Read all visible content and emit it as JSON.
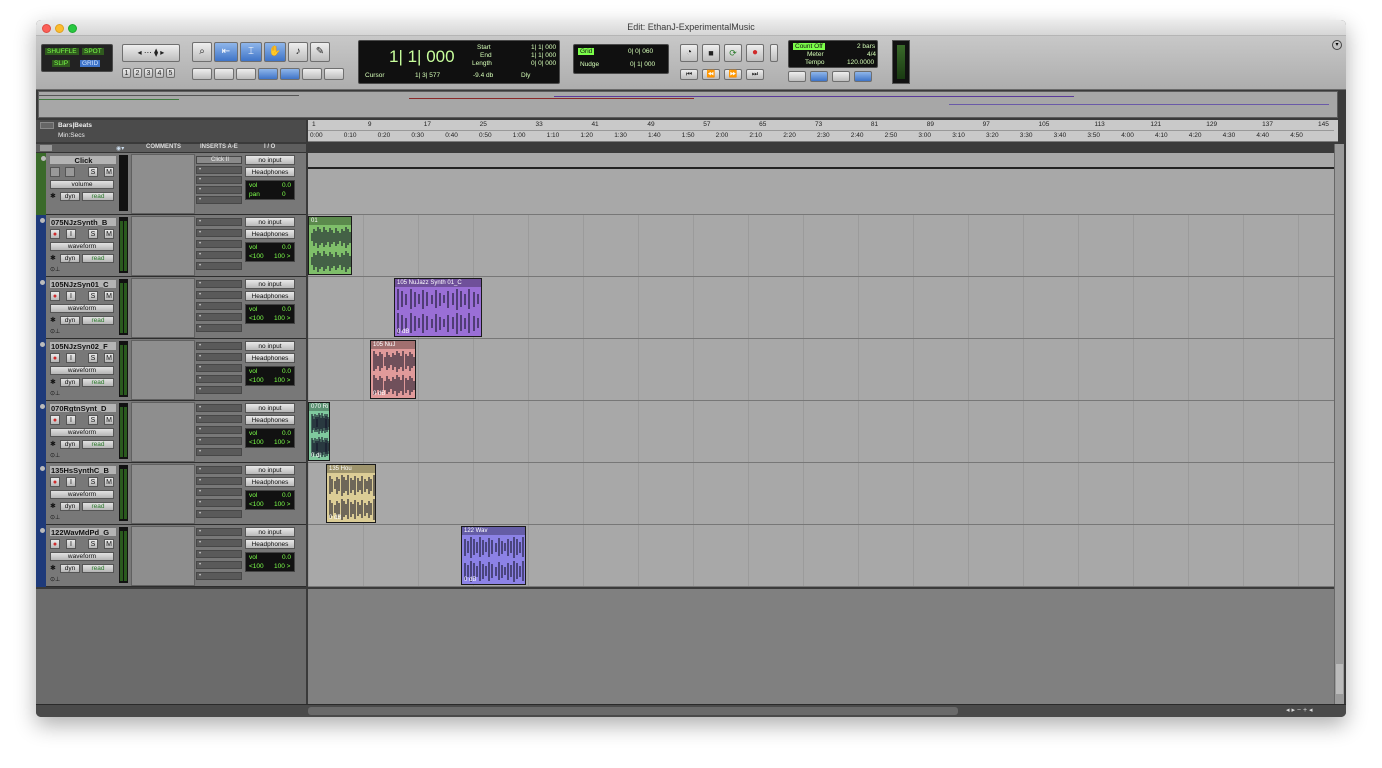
{
  "window": {
    "title": "Edit: EthanJ-ExperimentalMusic"
  },
  "edit_modes": [
    "SHUFFLE",
    "SPOT",
    "SLIP",
    "GRID"
  ],
  "zoom_presets": [
    "1",
    "2",
    "3",
    "4",
    "5"
  ],
  "counter": {
    "main": "1| 1| 000",
    "start_label": "Start",
    "start": "1| 1| 000",
    "end_label": "End",
    "end": "1| 1| 000",
    "length_label": "Length",
    "length": "0| 0| 000",
    "cursor_label": "Cursor",
    "cursor": "1| 3| 577",
    "db": "-9.4 db",
    "dly": "Dly"
  },
  "grid": {
    "grid_label": "Grid",
    "grid_value": "0| 0| 060",
    "nudge_label": "Nudge",
    "nudge_value": "0| 1| 000"
  },
  "midi_panel": {
    "count_off": "Count Off",
    "count_bars": "2 bars",
    "meter_label": "Meter",
    "meter": "4/4",
    "tempo_label": "Tempo",
    "tempo": "120.0000"
  },
  "rulers": {
    "bars_label": "Bars|Beats",
    "min_label": "Min:Secs",
    "bars": [
      "1",
      "9",
      "17",
      "25",
      "33",
      "41",
      "49",
      "57",
      "65",
      "73",
      "81",
      "89",
      "97",
      "105",
      "113",
      "121",
      "129",
      "137",
      "145"
    ],
    "mins": [
      "0:00",
      "0:10",
      "0:20",
      "0:30",
      "0:40",
      "0:50",
      "1:00",
      "1:10",
      "1:20",
      "1:30",
      "1:40",
      "1:50",
      "2:00",
      "2:10",
      "2:20",
      "2:30",
      "2:40",
      "2:50",
      "3:00",
      "3:10",
      "3:20",
      "3:30",
      "3:40",
      "3:50",
      "4:00",
      "4:10",
      "4:20",
      "4:30",
      "4:40",
      "4:50"
    ]
  },
  "column_headers": {
    "comments": "COMMENTS",
    "inserts": "INSERTS A-E",
    "io": "I / O"
  },
  "click_track": {
    "name": "Click",
    "view": "volume",
    "insert": "Click II",
    "input": "no input",
    "output": "Headphones",
    "auto": "dyn",
    "mode": "read",
    "vol_label": "vol",
    "vol": "0.0",
    "pan_label": "pan",
    "pan": "0"
  },
  "tracks": [
    {
      "name": "075NJzSynth_B",
      "view": "waveform",
      "input": "no input",
      "output": "Headphones",
      "auto": "dyn",
      "mode": "read",
      "vol_label": "vol",
      "vol": "0.0",
      "pan_l": "<100",
      "pan_r": "100 >",
      "clip": {
        "name": "01",
        "gain": "",
        "color": "#7fbf6a"
      }
    },
    {
      "name": "105NJzSyn01_C",
      "view": "waveform",
      "input": "no input",
      "output": "Headphones",
      "auto": "dyn",
      "mode": "read",
      "vol_label": "vol",
      "vol": "0.0",
      "pan_l": "<100",
      "pan_r": "100 >",
      "clip": {
        "name": "105 NuJazz Synth 01_C",
        "gain": "0 dB",
        "color": "#9a6fd6"
      }
    },
    {
      "name": "105NJzSyn02_F",
      "view": "waveform",
      "input": "no input",
      "output": "Headphones",
      "auto": "dyn",
      "mode": "read",
      "vol_label": "vol",
      "vol": "0.0",
      "pan_l": "<100",
      "pan_r": "100 >",
      "clip": {
        "name": "105 NuJ",
        "gain": "0 dB",
        "color": "#e09a9a"
      }
    },
    {
      "name": "070RgtnSynt_D",
      "view": "waveform",
      "input": "no input",
      "output": "Headphones",
      "auto": "dyn",
      "mode": "read",
      "vol_label": "vol",
      "vol": "0.0",
      "pan_l": "<100",
      "pan_r": "100 >",
      "clip": {
        "name": "070 Ri",
        "gain": "0 dl",
        "color": "#7fc99e"
      }
    },
    {
      "name": "135HsSynthC_B",
      "view": "waveform",
      "input": "no input",
      "output": "Headphones",
      "auto": "dyn",
      "mode": "read",
      "vol_label": "vol",
      "vol": "0.0",
      "pan_l": "<100",
      "pan_r": "100 >",
      "clip": {
        "name": "135 Hou",
        "gain": "0 dB",
        "color": "#dccd96"
      }
    },
    {
      "name": "122WavMdPd_G",
      "view": "waveform",
      "input": "no input",
      "output": "Headphones",
      "auto": "dyn",
      "mode": "read",
      "vol_label": "vol",
      "vol": "0.0",
      "pan_l": "<100",
      "pan_r": "100 >",
      "clip": {
        "name": "122 Wav",
        "gain": "0 dB",
        "color": "#8c82e6"
      }
    }
  ],
  "colors": {
    "accent": "#3f74c8",
    "lcd_text": "#7cff4a",
    "record": "#d02a2a"
  }
}
